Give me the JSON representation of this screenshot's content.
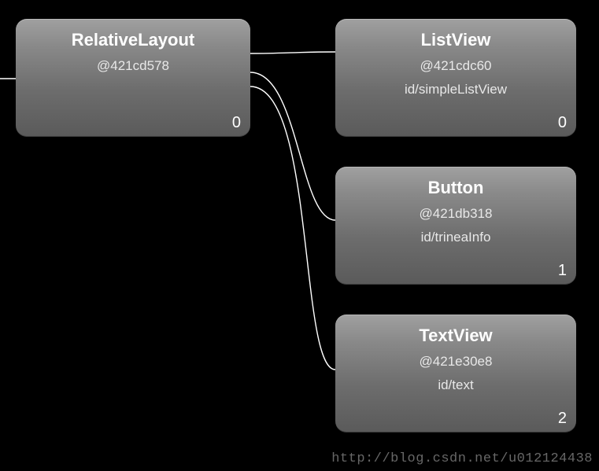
{
  "nodes": {
    "root": {
      "title": "RelativeLayout",
      "address": "@421cd578",
      "resource_id": "",
      "index": "0"
    },
    "child0": {
      "title": "ListView",
      "address": "@421cdc60",
      "resource_id": "id/simpleListView",
      "index": "0"
    },
    "child1": {
      "title": "Button",
      "address": "@421db318",
      "resource_id": "id/trineaInfo",
      "index": "1"
    },
    "child2": {
      "title": "TextView",
      "address": "@421e30e8",
      "resource_id": "id/text",
      "index": "2"
    }
  },
  "watermark": "http://blog.csdn.net/u012124438"
}
